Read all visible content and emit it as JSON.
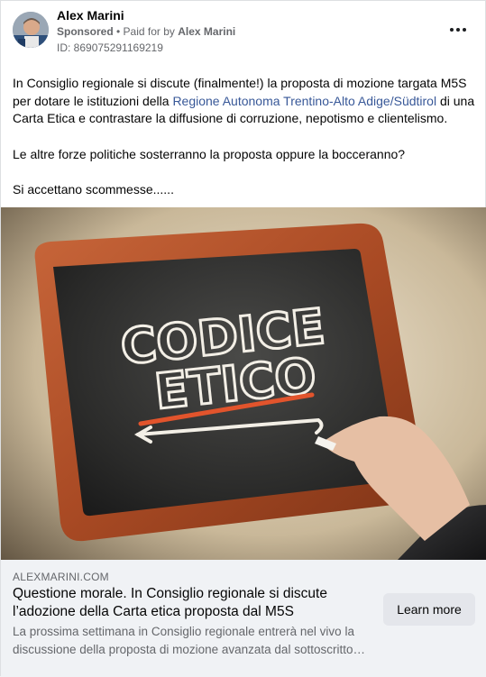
{
  "post": {
    "author": "Alex Marini",
    "sponsored": "Sponsored",
    "paid_prefix": " • Paid for by ",
    "paid_by": "Alex Marini",
    "ad_id": "ID: 869075291169219",
    "more_icon": "more-horizontal-icon"
  },
  "body": {
    "line1_before": "In Consiglio regionale si discute (finalmente!) la proposta di mozione targata M5S per dotare le istituzioni della ",
    "line1_link": "Regione Autonoma Trentino-Alto Adige/Südtirol",
    "line1_after": " di una Carta Etica e contrastare la diffusione di corruzione, nepotismo e clientelismo.",
    "line2": "Le altre forze politiche sosterranno la proposta oppure la bocceranno?",
    "line3": "Si accettano scommesse......"
  },
  "image": {
    "chalk_line1": "CODICE",
    "chalk_line2": "ETICO"
  },
  "link_preview": {
    "domain": "ALEXMARINI.COM",
    "headline": "Questione morale. In Consiglio regionale si discute l’adozione della Carta etica proposta dal M5S",
    "description": "La prossima settimana in Consiglio regionale entrerà nel vivo la discussione della proposta di mozione avanzata dal sottoscritto…",
    "cta_label": "Learn more"
  },
  "colors": {
    "link": "#385898",
    "secondary_text": "#65676b",
    "footer_bg": "#f0f2f5",
    "button_bg": "#e4e6eb",
    "frame_wood": "#b5532a"
  }
}
